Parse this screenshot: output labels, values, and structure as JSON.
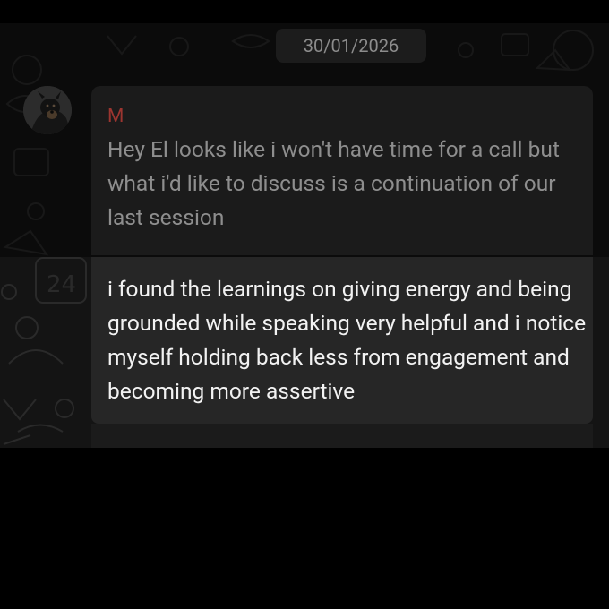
{
  "date_chip": "30/01/2026",
  "messages": [
    {
      "sender": "M",
      "text": "Hey El looks like i won't have time for a call but what i'd like to discuss is a continuation of our last session",
      "highlighted": false
    },
    {
      "text": "i found the learnings on giving energy and being grounded while speaking very helpful and i notice myself holding back less from engagement and becoming more assertive",
      "highlighted": true
    }
  ],
  "colors": {
    "sender_name": "#9c3530",
    "dimmed_text": "#8e8e8e",
    "highlighted_text": "#f2f2f2",
    "highlight_bg": "#262626"
  },
  "icons": {
    "avatar": "dog-photo-avatar"
  }
}
